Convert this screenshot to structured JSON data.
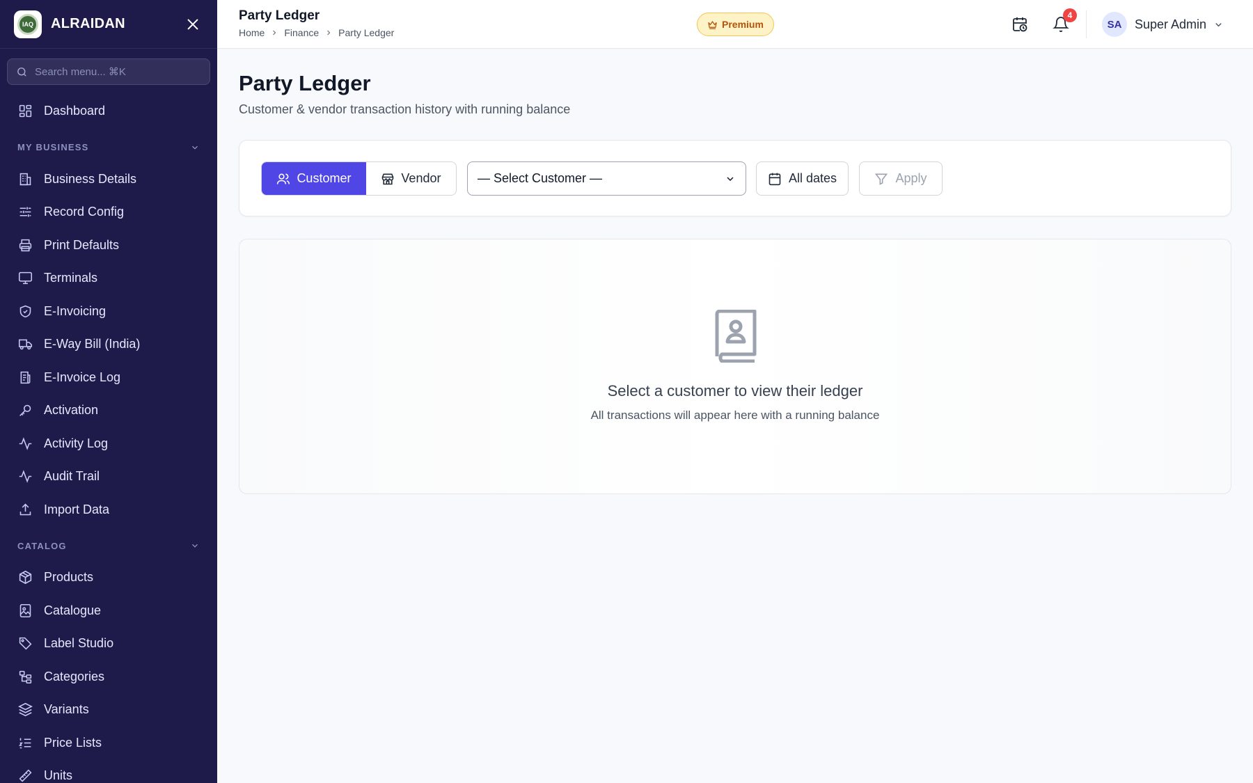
{
  "app": {
    "brand_name": "ALRAIDAN",
    "logo_text": "IAQ"
  },
  "sidebar": {
    "search_placeholder": "Search menu... ⌘K",
    "dashboard_label": "Dashboard",
    "sections": [
      {
        "title": "MY BUSINESS",
        "items": [
          {
            "label": "Business Details",
            "icon": "building-icon"
          },
          {
            "label": "Record Config",
            "icon": "sliders-icon"
          },
          {
            "label": "Print Defaults",
            "icon": "printer-icon"
          },
          {
            "label": "Terminals",
            "icon": "monitor-icon"
          },
          {
            "label": "E-Invoicing",
            "icon": "shield-check-icon"
          },
          {
            "label": "E-Way Bill (India)",
            "icon": "truck-icon"
          },
          {
            "label": "E-Invoice Log",
            "icon": "receipt-icon"
          },
          {
            "label": "Activation",
            "icon": "key-icon"
          },
          {
            "label": "Activity Log",
            "icon": "activity-icon"
          },
          {
            "label": "Audit Trail",
            "icon": "activity-icon"
          },
          {
            "label": "Import Data",
            "icon": "upload-icon"
          }
        ]
      },
      {
        "title": "CATALOG",
        "items": [
          {
            "label": "Products",
            "icon": "package-icon"
          },
          {
            "label": "Catalogue",
            "icon": "image-icon"
          },
          {
            "label": "Label Studio",
            "icon": "tag-icon"
          },
          {
            "label": "Categories",
            "icon": "tree-icon"
          },
          {
            "label": "Variants",
            "icon": "layers-icon"
          },
          {
            "label": "Price Lists",
            "icon": "list-ordered-icon"
          },
          {
            "label": "Units",
            "icon": "ruler-icon"
          }
        ]
      }
    ]
  },
  "header": {
    "title": "Party Ledger",
    "breadcrumbs": [
      "Home",
      "Finance",
      "Party Ledger"
    ],
    "premium_label": "Premium",
    "notification_count": "4",
    "user_initials": "SA",
    "user_name": "Super Admin"
  },
  "page": {
    "title": "Party Ledger",
    "subtitle": "Customer & vendor transaction history with running balance"
  },
  "filters": {
    "party_types": [
      "Customer",
      "Vendor"
    ],
    "active_party_type": "Customer",
    "select_value": "— Select Customer —",
    "date_label": "All dates",
    "apply_label": "Apply"
  },
  "empty_state": {
    "title": "Select a customer to view their ledger",
    "subtitle": "All transactions will appear here with a running balance"
  },
  "colors": {
    "sidebar_bg": "#1e1b4b",
    "accent": "#4f46e5",
    "badge": "#ef4444",
    "premium": "#b45309"
  }
}
